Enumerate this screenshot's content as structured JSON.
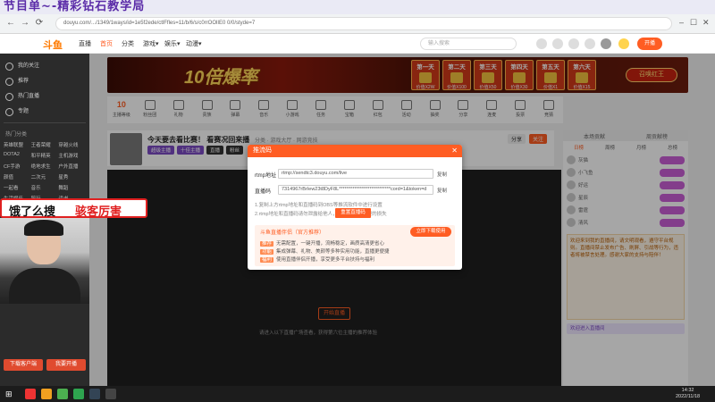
{
  "program_banner": {
    "title": "节目单~-精彩钻石教学局"
  },
  "browser": {
    "back": "←",
    "forward": "→",
    "reload": "⟳",
    "url": "douyu.com/.../1349/1ways/id=1e5f2ede/ctlFfles=11/b/6/s/c0rrOOlIE0 0/0/styde=7",
    "minimize": "–",
    "maximize": "☐",
    "close": "✕"
  },
  "site_header": {
    "logo": "斗鱼",
    "nav": [
      "直播",
      "首页",
      "分类",
      "游戏▾",
      "娱乐▾",
      "动漫▾"
    ],
    "active_nav_index": 1,
    "search_placeholder": "输入搜索",
    "live_button": "开播"
  },
  "sidebar": {
    "items": [
      {
        "label": "我的关注",
        "icon": "heart-icon"
      },
      {
        "label": "推荐",
        "icon": "star-icon"
      },
      {
        "label": "热门直播",
        "icon": "fire-icon"
      },
      {
        "label": "专题",
        "icon": "topic-icon"
      }
    ],
    "section_title": "热门分类",
    "categories": [
      "英雄联盟",
      "王者荣耀",
      "穿越火线",
      "DOTA2",
      "和平精英",
      "主机游戏",
      "CF手游",
      "绝地求生",
      "户外直播",
      "颜值",
      "二次元",
      "星秀",
      "一起看",
      "音乐",
      "舞蹈",
      "生活娱乐",
      "陪玩",
      "读书"
    ],
    "bottom_buttons": [
      "下载客户端",
      "我要开播"
    ]
  },
  "ad": {
    "title": "10倍爆率",
    "days": [
      {
        "day": "第一天",
        "prize": "价值X2W"
      },
      {
        "day": "第二天",
        "prize": "价值X100"
      },
      {
        "day": "第三天",
        "prize": "价值X50"
      },
      {
        "day": "第四天",
        "prize": "价值X30"
      },
      {
        "day": "第五天",
        "prize": "价值X1"
      },
      {
        "day": "第六天",
        "prize": "价值X15"
      }
    ],
    "cta": "召唤红王"
  },
  "gift_bar": {
    "level": "10",
    "items": [
      "主播等级",
      "粉丝团",
      "礼物",
      "贵族",
      "弹幕",
      "音乐",
      "小游戏",
      "任务",
      "宝箱",
      "红包",
      "活动",
      "抽奖",
      "分享",
      "连麦",
      "投票",
      "竞猜"
    ]
  },
  "room": {
    "title": "今天要去看比赛！ 看赛况回来播",
    "sub": "分类 · 游戏大厅 · 网游竞技",
    "tags": [
      "超级主播",
      "十佳主播",
      "直播",
      "粉丝"
    ],
    "right_tags": [
      "分享",
      "关注"
    ],
    "start_button": "开始直播",
    "note": "请进入以下直播广场查看，获得第六位主播的推荐体验"
  },
  "right_panel": {
    "head": [
      "本场贡献",
      "周贡献榜"
    ],
    "tabs": [
      "日榜",
      "周榜",
      "月榜",
      "总榜"
    ],
    "active_tab_index": 0,
    "ranks": [
      "灰猫",
      "小飞鱼",
      "好运",
      "星辰",
      "雷霆",
      "清风"
    ],
    "notice": "欢迎来到我的直播间，请文明观看，遵守平台规则。直播间禁止发布广告、刷屏、引战等行为，违者将被禁言处理。感谢大家的支持与陪伴！",
    "chat": "欢迎进入直播间"
  },
  "modal": {
    "title": "推流码",
    "close": "✕",
    "url_label": "rtmp地址",
    "url_value": "rtmp://sendtc3.douyu.com/live",
    "code_label": "直播码",
    "code_value": "7314967rBrIew23t8DyF8L***************************cord=1&token=d",
    "copy": "复制",
    "note1": "1.复制上方rtmp地址和直播码到OBS等推流软件中进行设置",
    "note2": "2.rtmp地址和直播码请勿泄露给他人，以免造成不必要的损失",
    "reset_button": "重置直播码",
    "tip_title": "斗鱼直播伴侣（官方推荐）",
    "tip_button": "立即下载使用",
    "tip_lines": [
      {
        "tag": "推荐",
        "text": "无需配置，一键开播，流畅稳定，画质高清更省心"
      },
      {
        "tag": "功能",
        "text": "集成弹幕、礼物、美颜等多种实用功能，直播更便捷"
      },
      {
        "tag": "福利",
        "text": "使用直播伴侣开播，享受更多平台扶持与福利"
      }
    ]
  },
  "sticker": {
    "text1": "饿了么搜",
    "text2": "骇客厉害"
  },
  "taskbar": {
    "start": "⊞",
    "time": "14:32",
    "date": "2022/11/18"
  },
  "colors": {
    "accent": "#ff5d23",
    "sidebar": "#2b2b2b",
    "purple": "#7b4ac4"
  }
}
